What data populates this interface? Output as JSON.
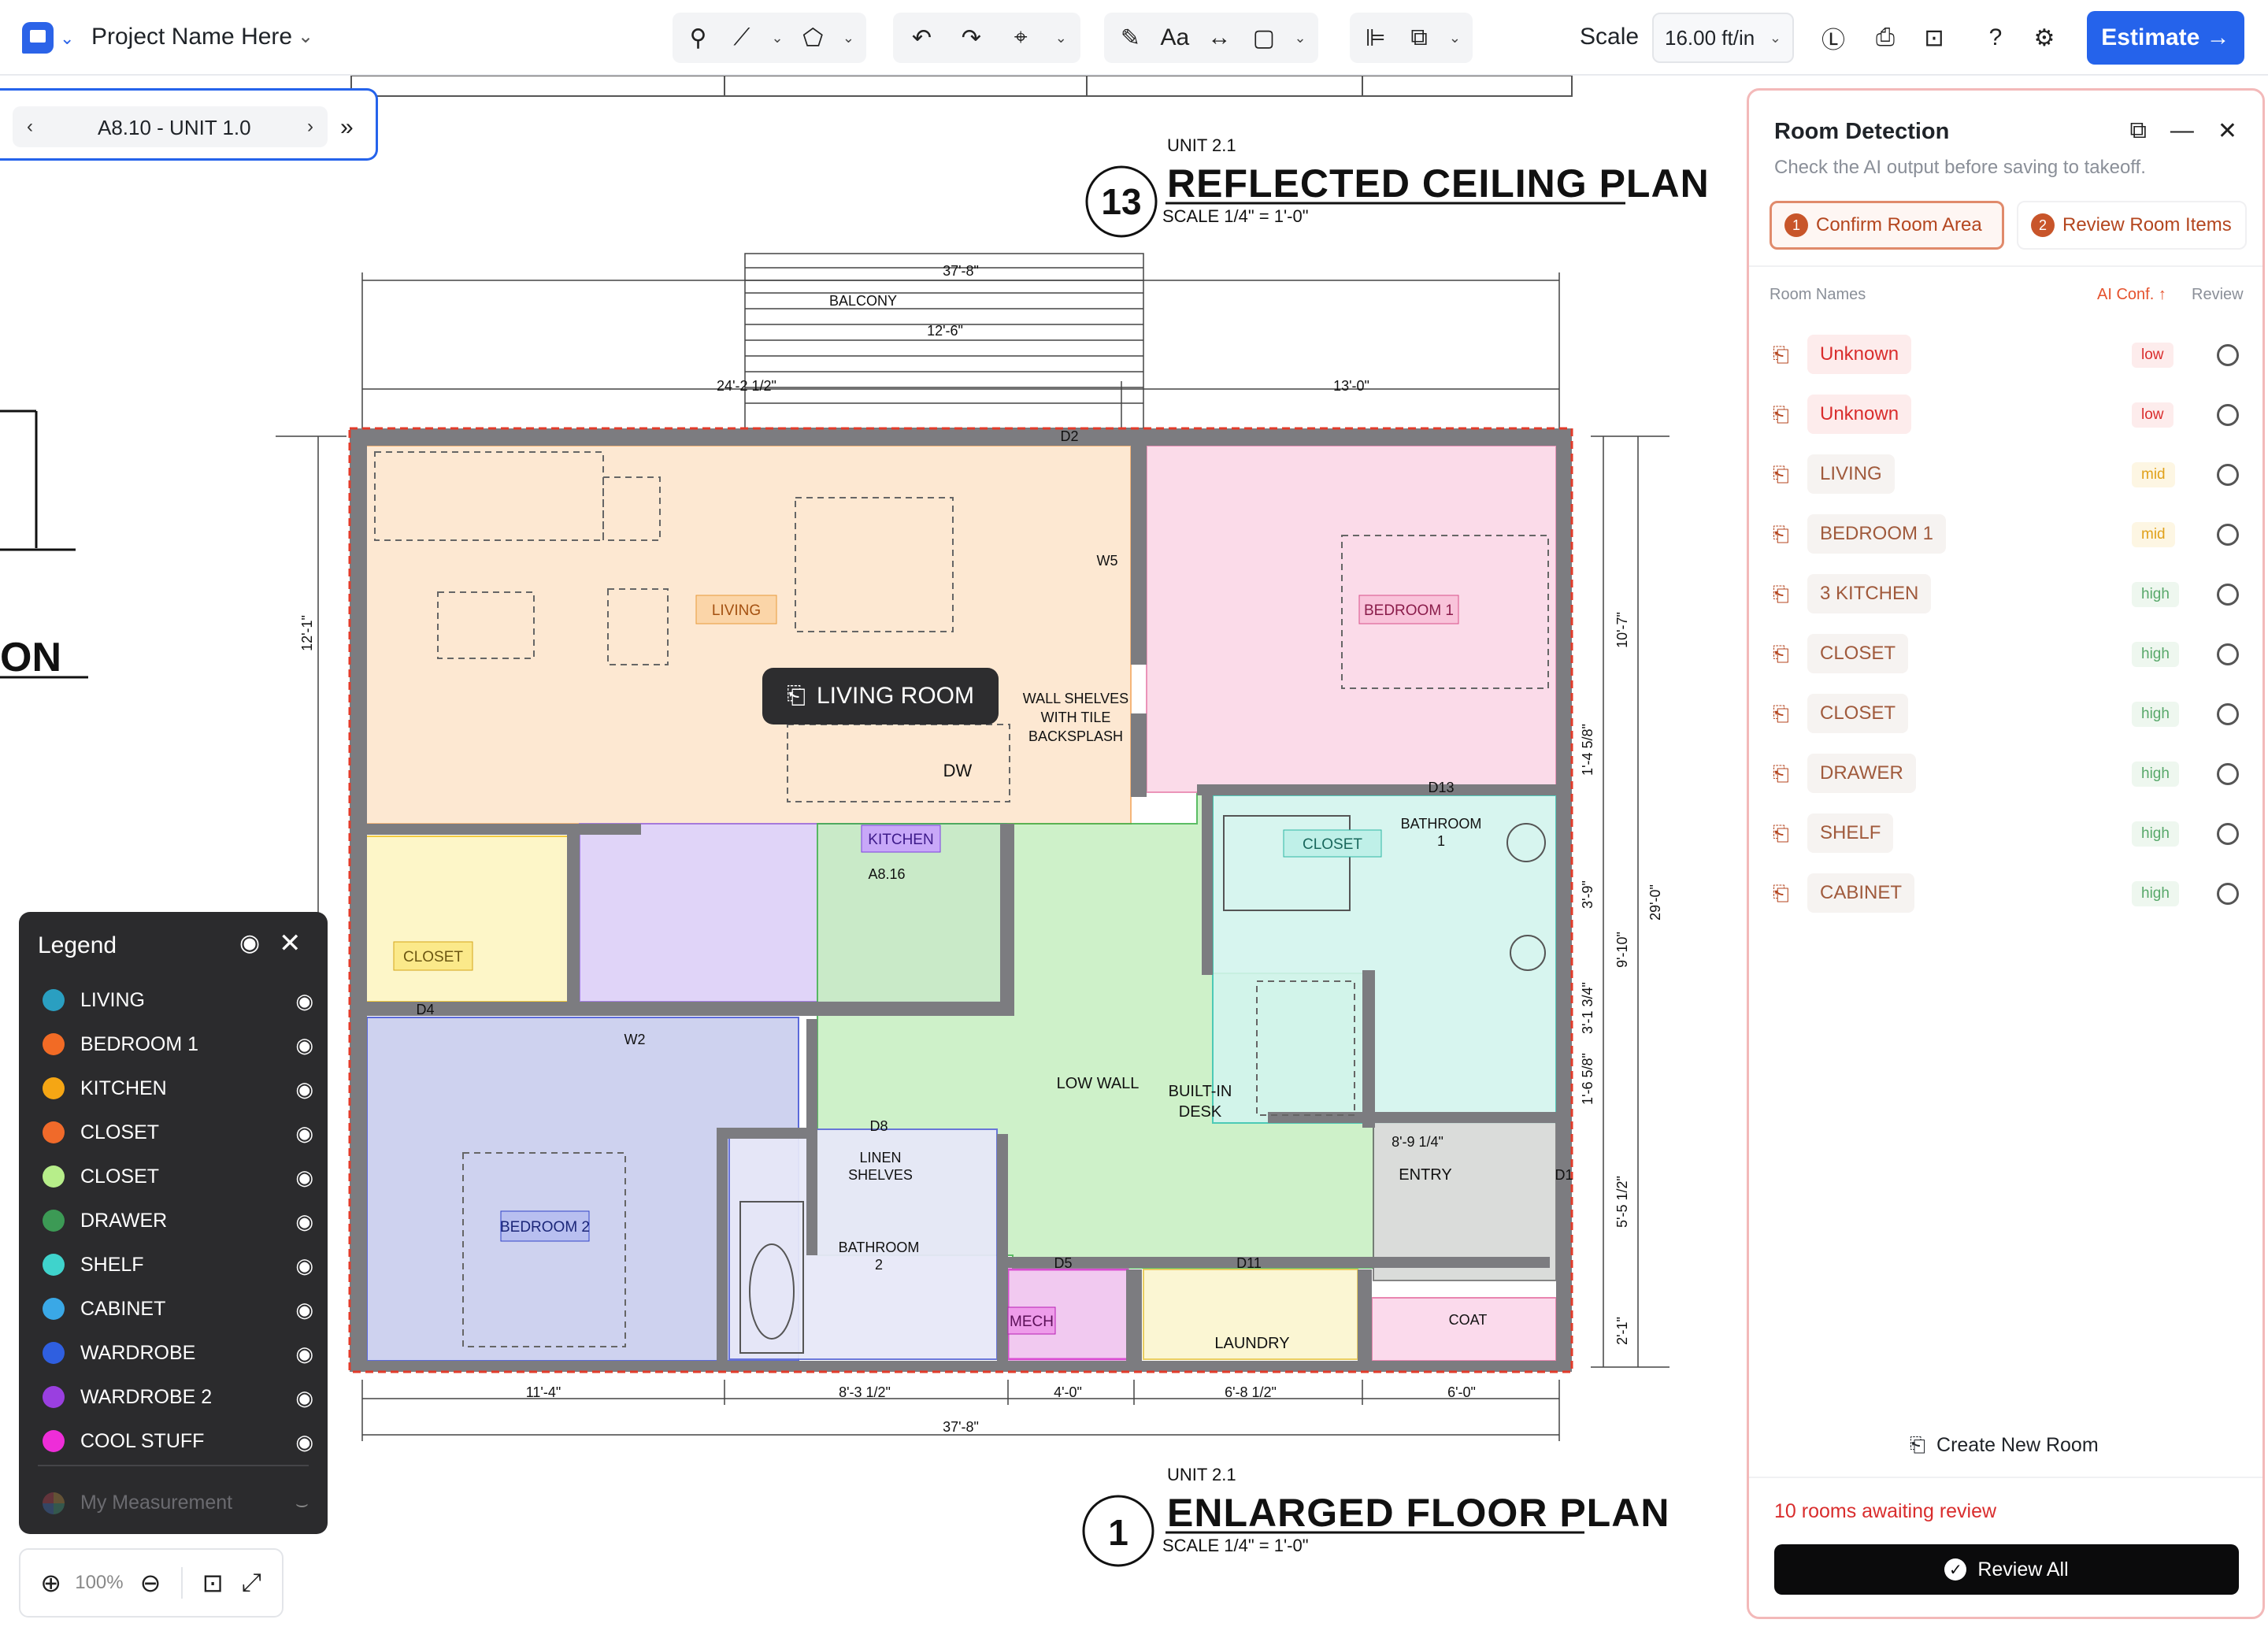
{
  "app": {
    "project_name": "Project Name Here"
  },
  "toolbar": {
    "scale_label": "Scale",
    "scale_value": "16.00 ft/in",
    "estimate_label": "Estimate →"
  },
  "sheet_nav": {
    "prev": "‹",
    "label": "A8.10 - UNIT 1.0",
    "next": "›",
    "expand": "»"
  },
  "drawing": {
    "top_title": {
      "unit": "UNIT 2.1",
      "number": "13",
      "title": "REFLECTED CEILING PLAN",
      "scale": "SCALE  1/4\" = 1'-0\""
    },
    "bottom_title": {
      "unit": "UNIT 2.1",
      "number": "1",
      "title": "ENLARGED FLOOR PLAN",
      "scale": "SCALE  1/4\" = 1'-0\""
    },
    "left_fragment": "ON",
    "dimensions": {
      "top_overall": "37'-8\"",
      "balcony_width": "12'-6\"",
      "left_top": "24'-2 1/2\"",
      "right_top": "13'-0\"",
      "bottom_overall": "37'-8\"",
      "bottom_1": "11'-4\"",
      "bottom_2": "8'-3 1/2\"",
      "bottom_3": "4'-0\"",
      "bottom_4": "6'-8 1/2\"",
      "bottom_5": "6'-0\"",
      "right_1": "10'-7\"",
      "right_2": "1'-4 5/8\"",
      "right_3": "3'-9\"",
      "right_4": "9'-10\"",
      "right_5": "3'-1 3/4\"",
      "right_6": "1'-6 5/8\"",
      "right_7": "5'-5 1/2\"",
      "right_8": "2'-1\"",
      "right_overall": "29'-0\"",
      "left_1": "12'-1\""
    },
    "labels": {
      "balcony": "BALCONY",
      "living": "LIVING",
      "bedroom1": "BEDROOM 1",
      "bedroom2": "BEDROOM 2",
      "closet": "CLOSET",
      "closet2": "CLOSET",
      "kitchen": "KITCHEN",
      "bathroom1": "BATHROOM",
      "bathroom1_num": "1",
      "bathroom2": "BATHROOM",
      "bathroom2_num": "2",
      "wall_shelves": "WALL SHELVES",
      "wall_shelves_2": "WITH TILE",
      "wall_shelves_3": "BACKSPLASH",
      "linen": "LINEN",
      "linen_2": "SHELVES",
      "low_wall": "LOW WALL",
      "built_in": "BUILT-IN",
      "desk": "DESK",
      "entry": "ENTRY",
      "mech": "MECH",
      "laundry": "LAUNDRY",
      "coat": "COAT",
      "dw": "DW",
      "d2": "D2",
      "d4": "D4",
      "d5": "D5",
      "d8": "D8",
      "d11": "D11",
      "d13": "D13",
      "d1": "D1",
      "w2": "W2",
      "w5": "W5",
      "a816": "A8.16",
      "entry_dim": "8'-9 1/4\""
    },
    "tooltip": "LIVING ROOM"
  },
  "legend": {
    "title": "Legend",
    "items": [
      {
        "label": "LIVING",
        "color": "#2a9fc1"
      },
      {
        "label": "BEDROOM 1",
        "color": "#f26b25"
      },
      {
        "label": "KITCHEN",
        "color": "#f5a614"
      },
      {
        "label": "CLOSET",
        "color": "#f06a2a"
      },
      {
        "label": "CLOSET",
        "color": "#b7ee8a"
      },
      {
        "label": "DRAWER",
        "color": "#3c9a55"
      },
      {
        "label": "SHELF",
        "color": "#3fd3cc"
      },
      {
        "label": "CABINET",
        "color": "#3aa8e6"
      },
      {
        "label": "WARDROBE",
        "color": "#2f5fe0"
      },
      {
        "label": "WARDROBE 2",
        "color": "#9a3fe0"
      },
      {
        "label": "COOL STUFF",
        "color": "#ee2dd8"
      }
    ],
    "measurement_label": "My Measurement"
  },
  "zoom": {
    "value": "100%"
  },
  "panel": {
    "title": "Room Detection",
    "subtitle": "Check the AI output before saving to takeoff.",
    "step1_num": "1",
    "step1_label": "Confirm Room Area",
    "step2_num": "2",
    "step2_label": "Review Room Items",
    "col_names": "Room Names",
    "col_conf": "AI Conf. ↑",
    "col_review": "Review",
    "rooms": [
      {
        "name": "Unknown",
        "conf": "low"
      },
      {
        "name": "Unknown",
        "conf": "low"
      },
      {
        "name": "LIVING",
        "conf": "mid"
      },
      {
        "name": "BEDROOM 1",
        "conf": "mid"
      },
      {
        "name": "3 KITCHEN",
        "conf": "high"
      },
      {
        "name": "CLOSET",
        "conf": "high"
      },
      {
        "name": "CLOSET",
        "conf": "high"
      },
      {
        "name": "DRAWER",
        "conf": "high"
      },
      {
        "name": "SHELF",
        "conf": "high"
      },
      {
        "name": "CABINET",
        "conf": "high"
      }
    ],
    "create_room": "Create New Room",
    "awaiting": "10 rooms awaiting review",
    "review_all": "Review All"
  }
}
